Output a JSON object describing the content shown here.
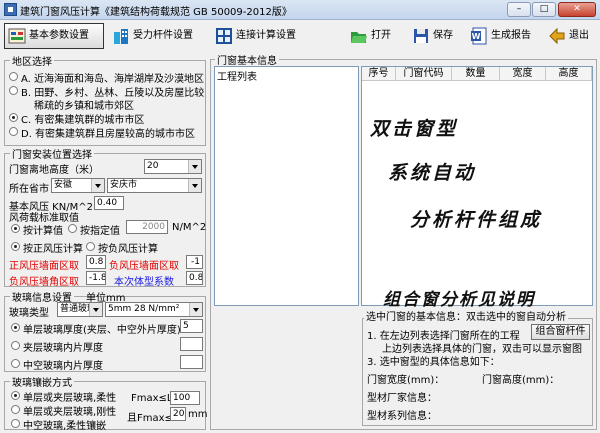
{
  "window": {
    "title": "建筑门窗风压计算《建筑结构荷载规范 GB 50009-2012版》",
    "min": "–",
    "max": "□",
    "close": "✕"
  },
  "toolbar": {
    "tab_basic": "基本参数设置",
    "tab_member": "受力杆件设置",
    "tab_connect": "连接计算设置",
    "open": "打开",
    "save": "保存",
    "report": "生成报告",
    "exit": "退出"
  },
  "region": {
    "title": "地区选择",
    "options": [
      "A. 近海海面和海岛、海岸湖岸及沙漠地区",
      "B. 田野、乡村、丛林、丘陵以及房屋比较",
      "稀疏的乡镇和城市郊区",
      "C. 有密集建筑群的城市市区",
      "D. 有密集建筑群且房屋较高的城市市区"
    ],
    "selected": "C"
  },
  "install": {
    "title": "门窗安装位置选择",
    "height_label": "门窗离地高度（米）",
    "height_value": "20",
    "city_label": "所在省市",
    "province": "安徽",
    "city": "安庆市",
    "base_wind_label": "基本风压  KN/M^2",
    "base_wind_value": "0.40",
    "std_title": "风荷载标准取值",
    "by_calc": "按计算值",
    "by_fixed": "按指定值",
    "fixed_value": "2000",
    "fixed_unit": "N/M^2",
    "positive_calc": "按正风压计算",
    "negative_calc": "按负风压计算",
    "pos_wall": "正风压墙面区取",
    "pos_wall_value": "0.8",
    "neg_wall": "负风压墙面区取",
    "neg_wall_value": "-1",
    "neg_corner": "负风压墙角区取",
    "neg_corner_value": "-1.8",
    "shape_coef": "本次体型系数",
    "shape_value": "0.8"
  },
  "glass": {
    "title": "玻璃信息设置",
    "unit": "单位mm",
    "type_label": "玻璃类型",
    "type_value": "普通玻璃",
    "spec_value": "5mm   28 N/mm²",
    "single": "单层玻璃厚度(夹层、中空外片厚度)",
    "single_value": "5",
    "laminated": "夹层玻璃内片厚度",
    "hollow": "中空玻璃内片厚度"
  },
  "embed": {
    "title": "玻璃镶嵌方式",
    "opt1": "单层或夹层玻璃,柔性",
    "opt2": "单层或夹层玻璃,刚性",
    "opt3": "中空玻璃,柔性镶嵌",
    "fmax1_label": "Fmax≤L/",
    "fmax1_value": "100",
    "fmax2_label": "且Fmax≤",
    "fmax2_value": "20",
    "fmax2_unit": "mm"
  },
  "door_info": {
    "title": "门窗基本信息",
    "list_title": "工程列表",
    "columns": [
      "序号",
      "门窗代码",
      "数量",
      "宽度",
      "高度"
    ]
  },
  "watermark": {
    "line1": "双击窗型",
    "line2": "系统自动",
    "line3": "分析杆件组成",
    "line4": "组合窗分析见说明"
  },
  "selected_info": {
    "title": "选中门窗的基本信息：双击选中的窗自动分析",
    "step1": "1. 在左边列表选择门窗所在的工程",
    "step2": "上边列表选择具体的门窗，双击可以显示窗图",
    "step3": "3. 选中窗型的具体信息如下：",
    "combine_btn": "组合窗杆件",
    "width_label": "门窗宽度(mm)：",
    "height_label": "门窗高度(mm)：",
    "vendor_label": "型材厂家信息：",
    "series_label": "型材系列信息："
  }
}
